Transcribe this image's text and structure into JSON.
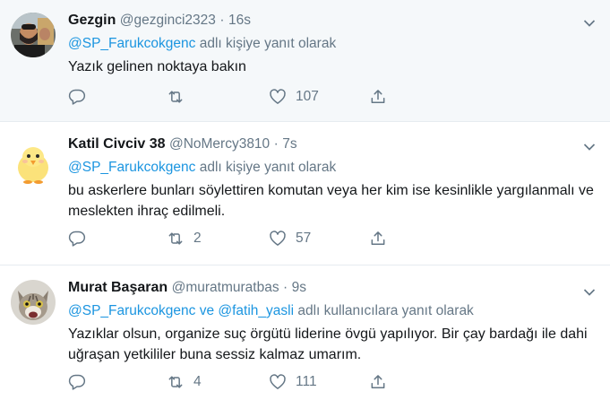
{
  "tweets": [
    {
      "display_name": "Gezgin",
      "handle": "@gezginci2323",
      "dot": "·",
      "time": "16s",
      "reply_mentions": [
        "@SP_Farukcokgenc"
      ],
      "reply_connector": "",
      "reply_suffix": "adlı kişiye yanıt olarak",
      "text": "Yazık gelinen noktaya bakın",
      "retweets": "",
      "likes": "107",
      "avatar_icon": "man-selfie-avatar"
    },
    {
      "display_name": "Katil Civciv 38",
      "handle": "@NoMercy3810",
      "dot": "·",
      "time": "7s",
      "reply_mentions": [
        "@SP_Farukcokgenc"
      ],
      "reply_connector": "",
      "reply_suffix": "adlı kişiye yanıt olarak",
      "text": "bu askerlere bunları söylettiren komutan veya her kim ise kesinlikle yargılanmalı ve meslekten ihraç edilmeli.",
      "retweets": "2",
      "likes": "57",
      "avatar_icon": "chick-avatar"
    },
    {
      "display_name": "Murat Başaran",
      "handle": "@muratmuratbas",
      "dot": "·",
      "time": "9s",
      "reply_mentions": [
        "@SP_Farukcokgenc",
        "@fatih_yasli"
      ],
      "reply_connector": "ve",
      "reply_suffix": "adlı kullanıcılara yanıt olarak",
      "text": "Yazıklar olsun,  organize suç örgütü liderine övgü yapılıyor. Bir çay bardağı ile dahi uğraşan yetkililer buna sessiz kalmaz umarım.",
      "retweets": "4",
      "likes": "111",
      "avatar_icon": "cat-avatar"
    }
  ],
  "colors": {
    "link": "#1b95e0",
    "secondary_text": "#657786",
    "primary_text": "#14171a",
    "highlight_bg": "#f5f8fa",
    "divider": "#e6ecf0"
  }
}
